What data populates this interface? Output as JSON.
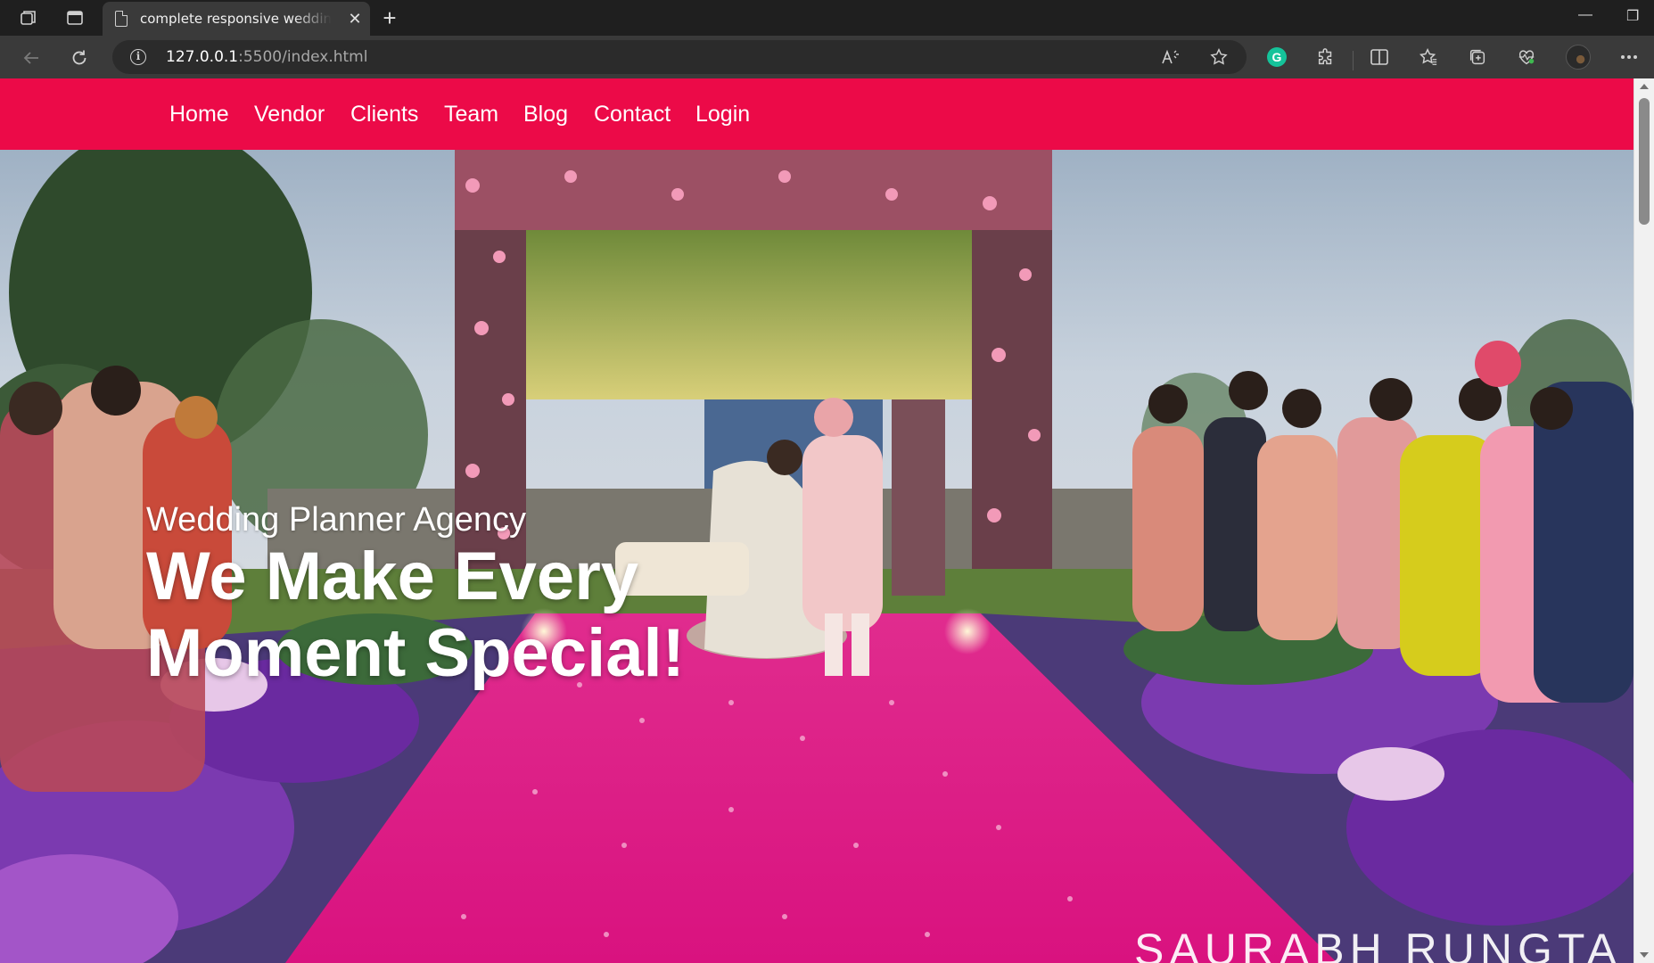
{
  "browser": {
    "tab": {
      "title": "complete responsive wedding planner",
      "close_glyph": "✕"
    },
    "new_tab_glyph": "+",
    "address": {
      "host": "127.0.0.1",
      "rest": ":5500/index.html"
    },
    "window_controls": {
      "minimize": "—",
      "restore": "❐"
    }
  },
  "nav": {
    "links": [
      "Home",
      "Vendor",
      "Clients",
      "Team",
      "Blog",
      "Contact",
      "Login"
    ]
  },
  "hero": {
    "subtitle": "Wedding Planner Agency",
    "title": "We Make Every Moment Special!",
    "watermark": "SAURABH RUNGTA"
  },
  "colors": {
    "navbar": "#ec0a48",
    "carpet": "#e01389",
    "chrome_dark": "#1f1f1f",
    "chrome_mid": "#3a3a3a"
  },
  "icons": {
    "workspaces": "workspaces-icon",
    "tab_actions": "tab-actions-icon",
    "back": "back-arrow-icon",
    "refresh": "refresh-icon",
    "site_info": "site-info-icon",
    "read_aloud": "read-aloud-icon",
    "favorite": "star-icon",
    "grammarly": "grammarly-icon",
    "extensions": "puzzle-icon",
    "split_screen": "split-screen-icon",
    "favorites": "favorites-icon",
    "collections": "collections-icon",
    "performance": "heartbeat-icon",
    "profile": "avatar",
    "menu": "more-icon"
  }
}
